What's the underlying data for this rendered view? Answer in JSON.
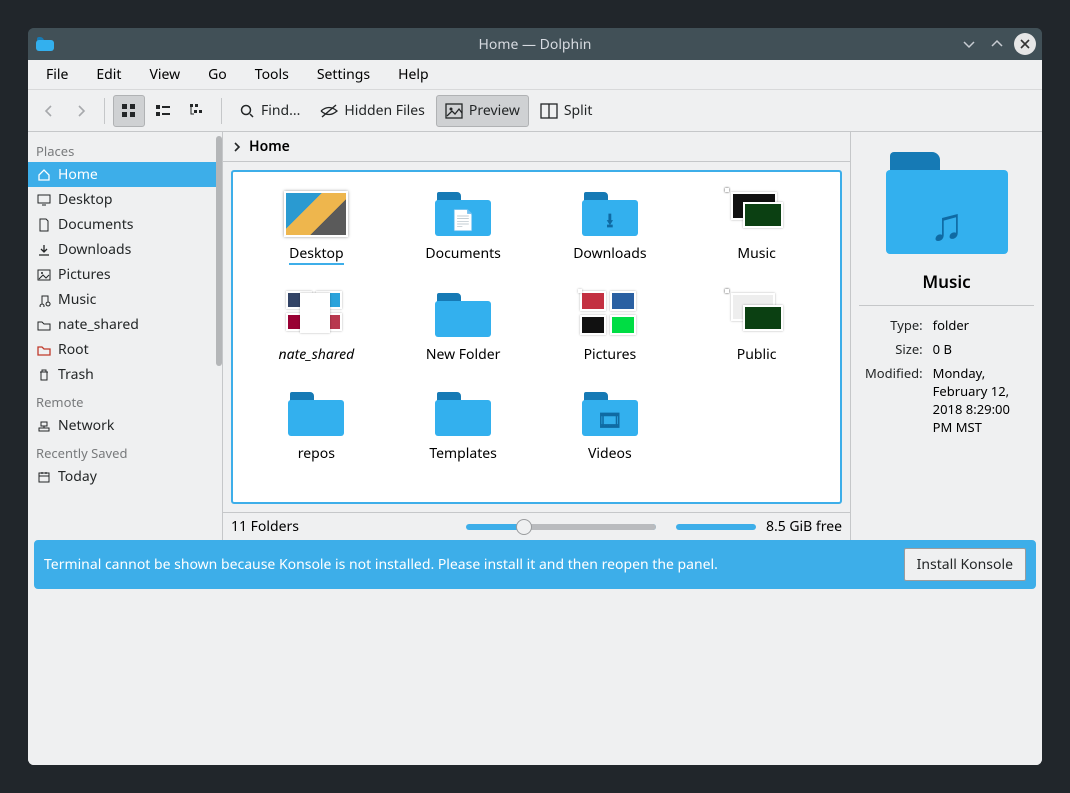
{
  "title": "Home — Dolphin",
  "menubar": [
    "File",
    "Edit",
    "View",
    "Go",
    "Tools",
    "Settings",
    "Help"
  ],
  "toolbar": {
    "find": "Find...",
    "hidden": "Hidden Files",
    "preview": "Preview",
    "split": "Split"
  },
  "breadcrumb": {
    "current": "Home"
  },
  "sidebar": {
    "sections": [
      {
        "header": "Places",
        "items": [
          {
            "label": "Home",
            "icon": "home",
            "selected": true
          },
          {
            "label": "Desktop",
            "icon": "monitor"
          },
          {
            "label": "Documents",
            "icon": "doc"
          },
          {
            "label": "Downloads",
            "icon": "download"
          },
          {
            "label": "Pictures",
            "icon": "image"
          },
          {
            "label": "Music",
            "icon": "music"
          },
          {
            "label": "nate_shared",
            "icon": "folder"
          },
          {
            "label": "Root",
            "icon": "folder-red"
          },
          {
            "label": "Trash",
            "icon": "trash"
          }
        ]
      },
      {
        "header": "Remote",
        "items": [
          {
            "label": "Network",
            "icon": "network"
          }
        ]
      },
      {
        "header": "Recently Saved",
        "items": [
          {
            "label": "Today",
            "icon": "calendar"
          }
        ]
      }
    ]
  },
  "items": [
    {
      "label": "Desktop",
      "kind": "desktop",
      "selected": true
    },
    {
      "label": "Documents",
      "kind": "folder",
      "glyph": "📄"
    },
    {
      "label": "Downloads",
      "kind": "folder",
      "glyph": "⭳"
    },
    {
      "label": "Music",
      "kind": "preview",
      "variant": "music"
    },
    {
      "label": "nate_shared",
      "kind": "preview",
      "variant": "nateshared",
      "italic": true
    },
    {
      "label": "New Folder",
      "kind": "folder",
      "glyph": ""
    },
    {
      "label": "Pictures",
      "kind": "preview",
      "variant": "pictures"
    },
    {
      "label": "Public",
      "kind": "preview",
      "variant": "public"
    },
    {
      "label": "repos",
      "kind": "folder",
      "glyph": ""
    },
    {
      "label": "Templates",
      "kind": "folder",
      "glyph": ""
    },
    {
      "label": "Videos",
      "kind": "folder",
      "glyph": "🎞"
    }
  ],
  "status": {
    "count": "11 Folders",
    "free": "8.5 GiB free"
  },
  "info": {
    "title": "Music",
    "rows": [
      {
        "k": "Type:",
        "v": "folder"
      },
      {
        "k": "Size:",
        "v": "0 B"
      },
      {
        "k": "Modified:",
        "v": "Monday, February 12, 2018 8:29:00 PM MST"
      }
    ]
  },
  "notification": {
    "text": "Terminal cannot be shown because Konsole is not installed. Please install it and then reopen the panel.",
    "button": "Install Konsole"
  }
}
